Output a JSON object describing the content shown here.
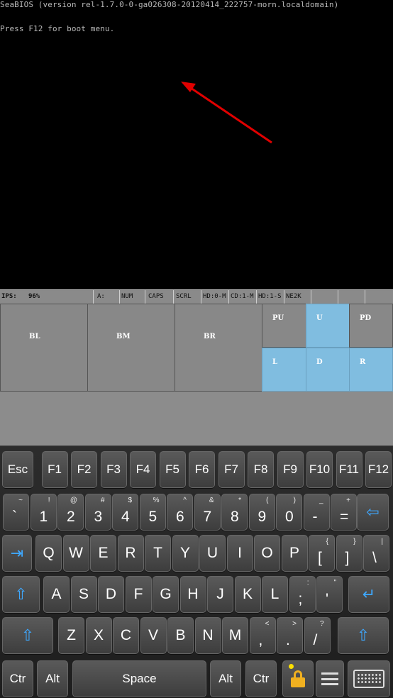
{
  "screen": {
    "bios_line1": "SeaBIOS (version rel-1.7.0-0-ga026308-20120414_222757-morn.localdomain)",
    "bios_line2": "Press F12 for boot menu.",
    "annotation_color": "#e00000"
  },
  "status_bar": {
    "ips_label": "IPS:",
    "ips_value": "96%",
    "drive": "A:",
    "num": "NUM",
    "caps": "CAPS",
    "scrl": "SCRL",
    "hd0": "HD:0-M",
    "cd1": "CD:1-M",
    "hd1": "HD:1-S",
    "ne2k": "NE2K"
  },
  "pad": {
    "bl": "BL",
    "bm": "BM",
    "br": "BR",
    "pu": "PU",
    "u": "U",
    "pd": "PD",
    "l": "L",
    "d": "D",
    "r": "R",
    "blue": "#80bde0",
    "gray": "#888888"
  },
  "keyboard": {
    "row0": [
      "Esc",
      "F1",
      "F2",
      "F3",
      "F4",
      "F5",
      "F6",
      "F7",
      "F8",
      "F9",
      "F10",
      "F11",
      "F12"
    ],
    "row1": [
      {
        "main": "`",
        "sup": "~"
      },
      {
        "main": "1",
        "sup": "!"
      },
      {
        "main": "2",
        "sup": "@"
      },
      {
        "main": "3",
        "sup": "#"
      },
      {
        "main": "4",
        "sup": "$"
      },
      {
        "main": "5",
        "sup": "%"
      },
      {
        "main": "6",
        "sup": "^"
      },
      {
        "main": "7",
        "sup": "&"
      },
      {
        "main": "8",
        "sup": "*"
      },
      {
        "main": "9",
        "sup": "("
      },
      {
        "main": "0",
        "sup": ")"
      },
      {
        "main": "-",
        "sup": "_"
      },
      {
        "main": "=",
        "sup": "+"
      }
    ],
    "row2": [
      {
        "main": "Q"
      },
      {
        "main": "W"
      },
      {
        "main": "E"
      },
      {
        "main": "R"
      },
      {
        "main": "T"
      },
      {
        "main": "Y"
      },
      {
        "main": "U"
      },
      {
        "main": "I"
      },
      {
        "main": "O"
      },
      {
        "main": "P"
      },
      {
        "main": "[",
        "sup": "{"
      },
      {
        "main": "]",
        "sup": "}"
      },
      {
        "main": "\\",
        "sup": "|"
      }
    ],
    "row3": [
      {
        "main": "A"
      },
      {
        "main": "S"
      },
      {
        "main": "D"
      },
      {
        "main": "F"
      },
      {
        "main": "G"
      },
      {
        "main": "H"
      },
      {
        "main": "J"
      },
      {
        "main": "K"
      },
      {
        "main": "L"
      },
      {
        "main": ";",
        "sup": ":"
      },
      {
        "main": "'",
        "sup": "\""
      }
    ],
    "row4": [
      {
        "main": "Z"
      },
      {
        "main": "X"
      },
      {
        "main": "C"
      },
      {
        "main": "V"
      },
      {
        "main": "B"
      },
      {
        "main": "N"
      },
      {
        "main": "M"
      },
      {
        "main": ",",
        "sup": "<"
      },
      {
        "main": ".",
        "sup": ">"
      },
      {
        "main": "/",
        "sup": "?"
      }
    ],
    "ctrl_left": "Ctr",
    "alt_left": "Alt",
    "space": "Space",
    "alt_right": "Alt",
    "ctrl_right": "Ctr",
    "icon_backspace": "backspace-icon",
    "icon_tab": "tab-icon",
    "icon_enter": "enter-icon",
    "icon_shift": "shift-icon",
    "icon_lock": "lock-icon",
    "icon_menu": "menu-icon",
    "icon_keyboard": "keyboard-icon",
    "accent": "#3ea8ff"
  }
}
